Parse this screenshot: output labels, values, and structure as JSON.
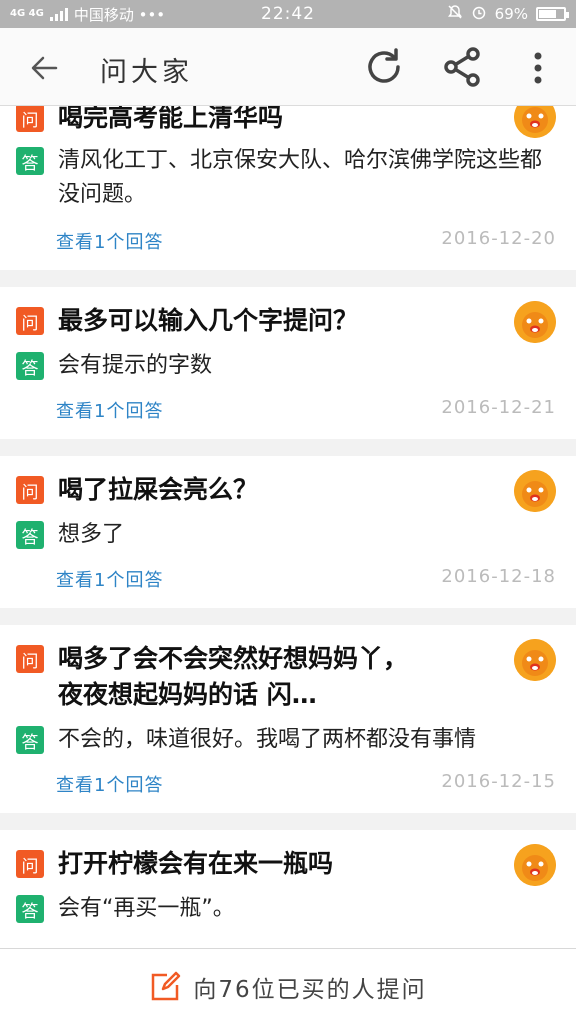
{
  "status": {
    "network": "4G 4G",
    "carrier": "中国移动 •••",
    "time": "22:42",
    "battery": "69%",
    "battery_level": 0.69
  },
  "header": {
    "title": "问大家"
  },
  "badges": {
    "question": "问",
    "answer": "答"
  },
  "items": [
    {
      "question": "喝完高考能上清华吗",
      "answer": "清风化工丁、北京保安大队、哈尔滨佛学院这些都没问题。",
      "link": "查看1个回答",
      "date": "2016-12-20"
    },
    {
      "question": "最多可以输入几个字提问？",
      "answer": "会有提示的字数",
      "link": "查看1个回答",
      "date": "2016-12-21"
    },
    {
      "question": "喝了拉屎会亮么？",
      "answer": "想多了",
      "link": "查看1个回答",
      "date": "2016-12-18"
    },
    {
      "question": "喝多了会不会突然好想妈妈丫， 夜夜想起妈妈的话 闪…",
      "answer": "不会的，味道很好。我喝了两杯都没有事情",
      "link": "查看1个回答",
      "date": "2016-12-15"
    },
    {
      "question": "打开柠檬会有在来一瓶吗",
      "answer": "会有“再买一瓶”。",
      "link": "",
      "date": ""
    }
  ],
  "bottom": {
    "ask_label": "向76位已买的人提问"
  },
  "colors": {
    "question_badge": "#f15a24",
    "answer_badge": "#1fb16f",
    "link": "#2e84c6",
    "avatar": "#f6a21e"
  }
}
